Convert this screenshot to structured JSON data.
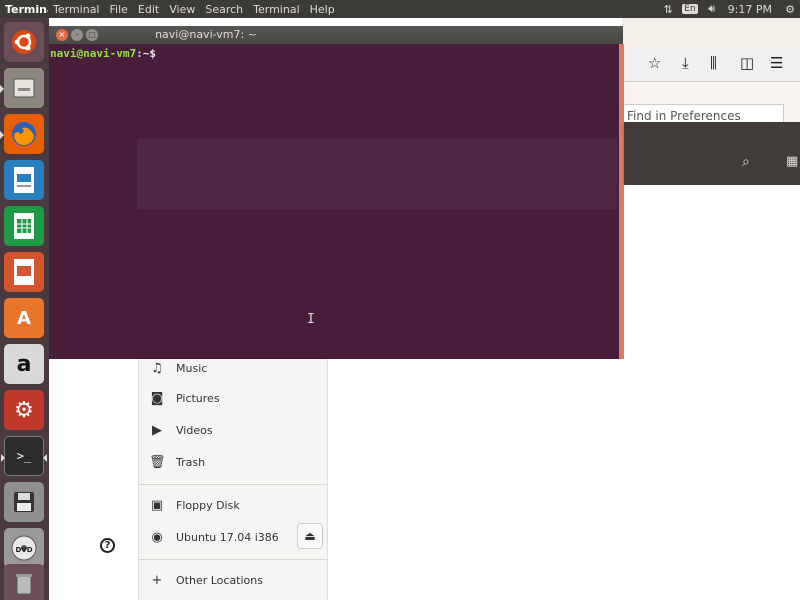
{
  "topbar": {
    "app_name": "Terminal",
    "menus": [
      "Terminal",
      "File",
      "Edit",
      "View",
      "Search",
      "Terminal",
      "Help"
    ],
    "keyboard": "En",
    "clock": "9:17 PM"
  },
  "launcher": {
    "items": [
      "Ubuntu Dash",
      "Files",
      "Firefox Web Browser",
      "LibreOffice Writer",
      "LibreOffice Calc",
      "LibreOffice Impress",
      "Ubuntu Software",
      "Amazon",
      "System Settings",
      "Terminal",
      "Floppy Disk",
      "Ubuntu 17.04 i386",
      "Trash"
    ]
  },
  "terminal": {
    "title": "navi@navi-vm7: ~",
    "prompt_user": "navi@navi-vm7",
    "prompt_path": ":~$"
  },
  "firefox": {
    "find_placeholder": "Find in Preferences"
  },
  "nautilus": {
    "places": [
      {
        "icon": "music-icon",
        "label": "Music"
      },
      {
        "icon": "camera-icon",
        "label": "Pictures"
      },
      {
        "icon": "video-icon",
        "label": "Videos"
      },
      {
        "icon": "trash-icon",
        "label": "Trash"
      }
    ],
    "devices": [
      {
        "icon": "floppy-icon",
        "label": "Floppy Disk"
      },
      {
        "icon": "disc-icon",
        "label": "Ubuntu 17.04 i386"
      }
    ],
    "other": {
      "icon": "plus-icon",
      "label": "Other Locations"
    }
  },
  "colors": {
    "terminal_bg": "#3a0c2c",
    "prompt_green": "#8ae234",
    "panel": "#3c3b37"
  }
}
